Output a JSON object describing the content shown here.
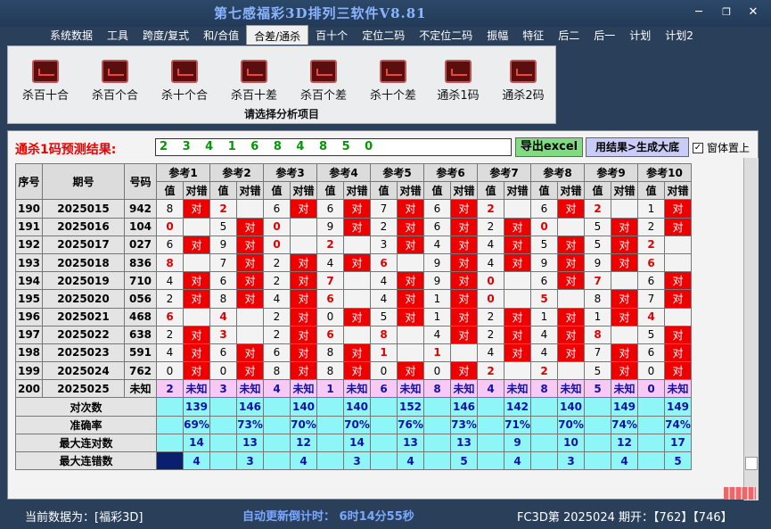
{
  "app": {
    "title": "第七感福彩3D排列三软件V8.81"
  },
  "window": {
    "minimize": "─",
    "restore": "❐",
    "close": "✕"
  },
  "menu": [
    "系统数据",
    "工具",
    "跨度/复式",
    "和/合值",
    "合差/通杀",
    "百十个",
    "定位二码",
    "不定位二码",
    "振幅",
    "特征",
    "后二",
    "后一",
    "计划",
    "计划2"
  ],
  "menu_active": 4,
  "ribbon": {
    "items": [
      "杀百十合",
      "杀百个合",
      "杀十个合",
      "杀百十差",
      "杀百个差",
      "杀十个差",
      "通杀1码",
      "通杀2码"
    ],
    "title": "请选择分析项目"
  },
  "prediction": {
    "label": "通杀1码预测结果:",
    "value": "2 3 4 1 6 8 4 8 5 0"
  },
  "buttons": {
    "export": "导出excel",
    "generate": "用结果>生成大底",
    "top_check": "窗体置上"
  },
  "table": {
    "h_idx": "序号",
    "h_period": "期号",
    "h_code": "号码",
    "refs": [
      "参考1",
      "参考2",
      "参考3",
      "参考4",
      "参考5",
      "参考6",
      "参考7",
      "参考8",
      "参考9",
      "参考10"
    ],
    "sub_val": "值",
    "sub_ok": "对错",
    "rows": [
      {
        "idx": "190",
        "period": "2025015",
        "code": "942",
        "cells": [
          [
            "8",
            "对"
          ],
          [
            "2",
            ""
          ],
          [
            "6",
            "对"
          ],
          [
            "6",
            "对"
          ],
          [
            "7",
            "对"
          ],
          [
            "6",
            "对"
          ],
          [
            "2",
            ""
          ],
          [
            "6",
            "对"
          ],
          [
            "2",
            ""
          ],
          [
            "1",
            "对"
          ]
        ]
      },
      {
        "idx": "191",
        "period": "2025016",
        "code": "104",
        "cells": [
          [
            "0",
            ""
          ],
          [
            "5",
            "对"
          ],
          [
            "0",
            ""
          ],
          [
            "9",
            "对"
          ],
          [
            "2",
            "对"
          ],
          [
            "6",
            "对"
          ],
          [
            "2",
            "对"
          ],
          [
            "0",
            ""
          ],
          [
            "5",
            "对"
          ],
          [
            "2",
            "对"
          ]
        ]
      },
      {
        "idx": "192",
        "period": "2025017",
        "code": "027",
        "cells": [
          [
            "6",
            "对"
          ],
          [
            "9",
            "对"
          ],
          [
            "0",
            ""
          ],
          [
            "2",
            ""
          ],
          [
            "3",
            "对"
          ],
          [
            "4",
            "对"
          ],
          [
            "4",
            "对"
          ],
          [
            "5",
            "对"
          ],
          [
            "5",
            "对"
          ],
          [
            "2",
            ""
          ]
        ]
      },
      {
        "idx": "193",
        "period": "2025018",
        "code": "836",
        "cells": [
          [
            "8",
            ""
          ],
          [
            "7",
            "对"
          ],
          [
            "2",
            "对"
          ],
          [
            "4",
            "对"
          ],
          [
            "6",
            ""
          ],
          [
            "9",
            "对"
          ],
          [
            "4",
            "对"
          ],
          [
            "9",
            "对"
          ],
          [
            "9",
            "对"
          ],
          [
            "6",
            ""
          ]
        ]
      },
      {
        "idx": "194",
        "period": "2025019",
        "code": "710",
        "cells": [
          [
            "4",
            "对"
          ],
          [
            "6",
            "对"
          ],
          [
            "2",
            "对"
          ],
          [
            "7",
            ""
          ],
          [
            "4",
            "对"
          ],
          [
            "9",
            "对"
          ],
          [
            "0",
            ""
          ],
          [
            "6",
            "对"
          ],
          [
            "7",
            ""
          ],
          [
            "6",
            "对"
          ]
        ]
      },
      {
        "idx": "195",
        "period": "2025020",
        "code": "056",
        "cells": [
          [
            "2",
            "对"
          ],
          [
            "8",
            "对"
          ],
          [
            "4",
            "对"
          ],
          [
            "6",
            ""
          ],
          [
            "4",
            "对"
          ],
          [
            "1",
            "对"
          ],
          [
            "0",
            ""
          ],
          [
            "5",
            ""
          ],
          [
            "8",
            "对"
          ],
          [
            "7",
            "对"
          ]
        ]
      },
      {
        "idx": "196",
        "period": "2025021",
        "code": "468",
        "cells": [
          [
            "6",
            ""
          ],
          [
            "4",
            ""
          ],
          [
            "2",
            "对"
          ],
          [
            "0",
            "对"
          ],
          [
            "5",
            "对"
          ],
          [
            "1",
            "对"
          ],
          [
            "2",
            "对"
          ],
          [
            "1",
            "对"
          ],
          [
            "1",
            "对"
          ],
          [
            "4",
            ""
          ]
        ]
      },
      {
        "idx": "197",
        "period": "2025022",
        "code": "638",
        "cells": [
          [
            "2",
            "对"
          ],
          [
            "3",
            ""
          ],
          [
            "2",
            "对"
          ],
          [
            "6",
            ""
          ],
          [
            "8",
            ""
          ],
          [
            "4",
            "对"
          ],
          [
            "2",
            "对"
          ],
          [
            "4",
            "对"
          ],
          [
            "8",
            ""
          ],
          [
            "5",
            "对"
          ]
        ]
      },
      {
        "idx": "198",
        "period": "2025023",
        "code": "591",
        "cells": [
          [
            "4",
            "对"
          ],
          [
            "6",
            "对"
          ],
          [
            "6",
            "对"
          ],
          [
            "8",
            "对"
          ],
          [
            "1",
            ""
          ],
          [
            "1",
            ""
          ],
          [
            "4",
            "对"
          ],
          [
            "4",
            "对"
          ],
          [
            "7",
            "对"
          ],
          [
            "6",
            "对"
          ]
        ]
      },
      {
        "idx": "199",
        "period": "2025024",
        "code": "762",
        "cells": [
          [
            "0",
            "对"
          ],
          [
            "0",
            "对"
          ],
          [
            "8",
            "对"
          ],
          [
            "8",
            "对"
          ],
          [
            "0",
            "对"
          ],
          [
            "0",
            "对"
          ],
          [
            "2",
            ""
          ],
          [
            "2",
            ""
          ],
          [
            "5",
            "对"
          ],
          [
            "0",
            "对"
          ]
        ]
      }
    ],
    "pending": {
      "idx": "200",
      "period": "2025025",
      "code": "未知",
      "cells": [
        [
          "2",
          "未知"
        ],
        [
          "3",
          "未知"
        ],
        [
          "4",
          "未知"
        ],
        [
          "1",
          "未知"
        ],
        [
          "6",
          "未知"
        ],
        [
          "8",
          "未知"
        ],
        [
          "4",
          "未知"
        ],
        [
          "8",
          "未知"
        ],
        [
          "5",
          "未知"
        ],
        [
          "0",
          "未知"
        ]
      ]
    },
    "stats": [
      {
        "label": "对次数",
        "values": [
          "139",
          "146",
          "140",
          "140",
          "152",
          "146",
          "142",
          "140",
          "149",
          "149"
        ]
      },
      {
        "label": "准确率",
        "values": [
          "69%",
          "73%",
          "70%",
          "70%",
          "76%",
          "73%",
          "71%",
          "70%",
          "74%",
          "74%"
        ]
      },
      {
        "label": "最大连对数",
        "values": [
          "14",
          "13",
          "12",
          "14",
          "13",
          "13",
          "9",
          "10",
          "12",
          "17"
        ]
      },
      {
        "label": "最大连错数",
        "values": [
          "4",
          "3",
          "4",
          "3",
          "4",
          "5",
          "4",
          "3",
          "4",
          "5"
        ]
      }
    ]
  },
  "status": {
    "data_source": "当前数据为：[福彩3D]",
    "countdown": "自动更新倒计时： 6时14分55秒",
    "latest": "FC3D第 2025024 期开：【762】【746】"
  },
  "colors": {
    "hit": "#e00000",
    "stats_bg": "#8ef6f6",
    "pending_bg": "#f7c9f7"
  }
}
